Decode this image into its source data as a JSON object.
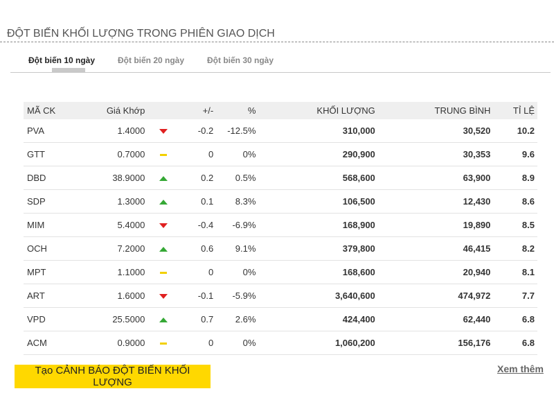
{
  "title": "ĐỘT BIẾN KHỐI LƯỢNG TRONG PHIÊN GIAO DỊCH",
  "tabs": [
    {
      "label": "Đột biến 10 ngày",
      "active": true
    },
    {
      "label": "Đột biến 20 ngày",
      "active": false
    },
    {
      "label": "Đột biến 30 ngày",
      "active": false
    }
  ],
  "table": {
    "headers": {
      "code": "MÃ CK",
      "price": "Giá Khớp",
      "change": "+/-",
      "percent": "%",
      "volume": "KHỐI LƯỢNG",
      "average": "TRUNG BÌNH",
      "ratio": "TỈ LỆ"
    },
    "rows": [
      {
        "code": "PVA",
        "price": "1.4000",
        "trend": "down",
        "change": "-0.2",
        "percent": "-12.5%",
        "volume": "310,000",
        "average": "30,520",
        "ratio": "10.2"
      },
      {
        "code": "GTT",
        "price": "0.7000",
        "trend": "flat",
        "change": "0",
        "percent": "0%",
        "volume": "290,900",
        "average": "30,353",
        "ratio": "9.6"
      },
      {
        "code": "DBD",
        "price": "38.9000",
        "trend": "up",
        "change": "0.2",
        "percent": "0.5%",
        "volume": "568,600",
        "average": "63,900",
        "ratio": "8.9"
      },
      {
        "code": "SDP",
        "price": "1.3000",
        "trend": "up",
        "change": "0.1",
        "percent": "8.3%",
        "volume": "106,500",
        "average": "12,430",
        "ratio": "8.6"
      },
      {
        "code": "MIM",
        "price": "5.4000",
        "trend": "down",
        "change": "-0.4",
        "percent": "-6.9%",
        "volume": "168,900",
        "average": "19,890",
        "ratio": "8.5"
      },
      {
        "code": "OCH",
        "price": "7.2000",
        "trend": "up",
        "change": "0.6",
        "percent": "9.1%",
        "volume": "379,800",
        "average": "46,415",
        "ratio": "8.2"
      },
      {
        "code": "MPT",
        "price": "1.1000",
        "trend": "flat",
        "change": "0",
        "percent": "0%",
        "volume": "168,600",
        "average": "20,940",
        "ratio": "8.1"
      },
      {
        "code": "ART",
        "price": "1.6000",
        "trend": "down",
        "change": "-0.1",
        "percent": "-5.9%",
        "volume": "3,640,600",
        "average": "474,972",
        "ratio": "7.7"
      },
      {
        "code": "VPD",
        "price": "25.5000",
        "trend": "up",
        "change": "0.7",
        "percent": "2.6%",
        "volume": "424,400",
        "average": "62,440",
        "ratio": "6.8"
      },
      {
        "code": "ACM",
        "price": "0.9000",
        "trend": "flat",
        "change": "0",
        "percent": "0%",
        "volume": "1,060,200",
        "average": "156,176",
        "ratio": "6.8"
      }
    ]
  },
  "alert_button": "Tạo CẢNH BÁO ĐỘT BIẾN KHỐI LƯỢNG",
  "more_link": "Xem thêm",
  "colors": {
    "code": "#2f5f9e",
    "volume": "#2e9b2e",
    "average": "#f08a1a",
    "ratio": "#d21fa8",
    "up": "#35a835",
    "down": "#e02020",
    "flat": "#f2d000",
    "button": "#ffd800"
  },
  "icons": {
    "up": "triangle-up-icon",
    "down": "triangle-down-icon",
    "flat": "dash-icon"
  }
}
